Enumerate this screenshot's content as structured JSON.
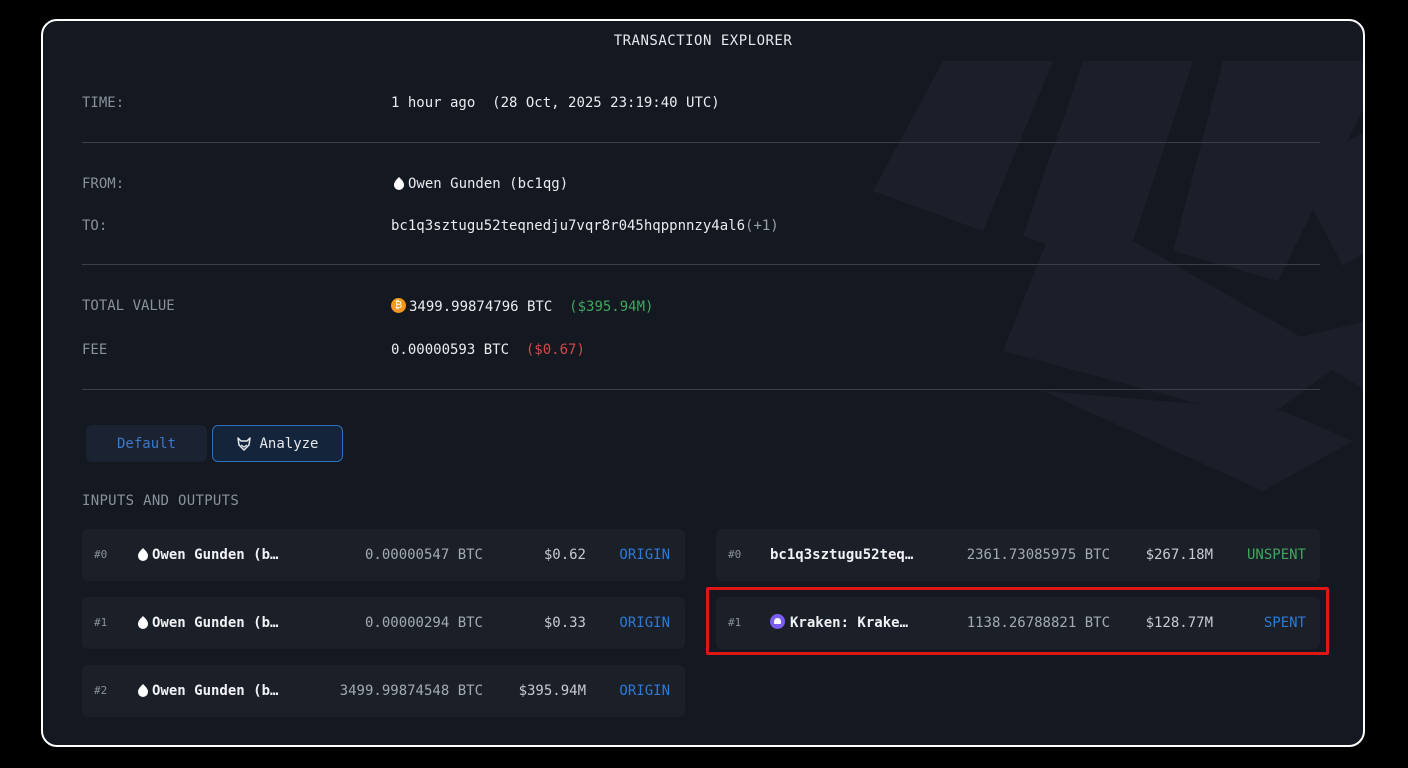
{
  "header": {
    "title": "TRANSACTION EXPLORER"
  },
  "time": {
    "label": "TIME:",
    "relative": "1 hour ago",
    "absolute": "(28 Oct, 2025 23:19:40 UTC)"
  },
  "from": {
    "label": "FROM:",
    "name": "Owen Gunden (bc1qg)"
  },
  "to": {
    "label": "TO:",
    "address": "bc1q3sztugu52teqnedju7vqr8r045hqppnnzy4al6",
    "extra": "(+1)"
  },
  "total_value": {
    "label": "TOTAL VALUE",
    "btc": "3499.99874796 BTC",
    "usd": "($395.94M)"
  },
  "fee": {
    "label": "FEE",
    "btc": "0.00000593 BTC",
    "usd": "($0.67)"
  },
  "tabs": {
    "default": "Default",
    "analyze": "Analyze"
  },
  "io_section": {
    "title": "INPUTS AND OUTPUTS"
  },
  "inputs": [
    {
      "index": "#0",
      "name": "Owen Gunden (b…",
      "amount": "0.00000547 BTC",
      "usd": "$0.62",
      "status": "ORIGIN"
    },
    {
      "index": "#1",
      "name": "Owen Gunden (b…",
      "amount": "0.00000294 BTC",
      "usd": "$0.33",
      "status": "ORIGIN"
    },
    {
      "index": "#2",
      "name": "Owen Gunden (b…",
      "amount": "3499.99874548 BTC",
      "usd": "$395.94M",
      "status": "ORIGIN"
    }
  ],
  "outputs": [
    {
      "index": "#0",
      "name": "bc1q3sztugu52teq…",
      "amount": "2361.73085975 BTC",
      "usd": "$267.18M",
      "status": "UNSPENT"
    },
    {
      "index": "#1",
      "name": "Kraken: Krake…",
      "amount": "1138.26788821 BTC",
      "usd": "$128.77M",
      "status": "SPENT"
    }
  ],
  "colors": {
    "accent_blue": "#2d7ad6",
    "positive": "#3fa65f",
    "negative": "#d04a4a",
    "highlight": "#e01515",
    "btc": "#f29a16",
    "kraken": "#7b5ef0"
  }
}
